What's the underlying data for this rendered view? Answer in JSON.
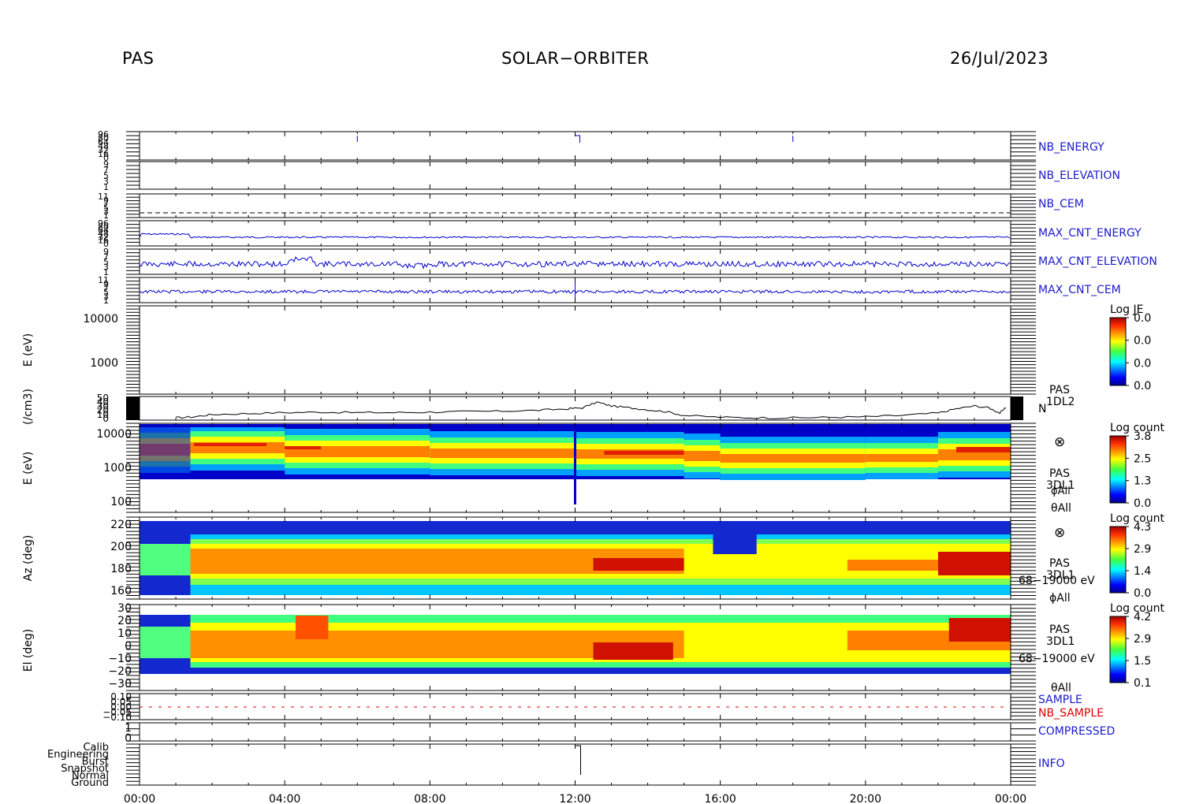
{
  "header": {
    "instrument": "PAS",
    "mission": "SOLAR−ORBITER",
    "date": "26/Jul/2023"
  },
  "colors": {
    "blue_label": "#1a1acc",
    "trace_blue": "#0000cc",
    "red_label": "#dd0000"
  },
  "chart_data": {
    "type": "heatmap",
    "x_ticks": [
      "00:00",
      "04:00",
      "08:00",
      "12:00",
      "16:00",
      "20:00",
      "00:00"
    ],
    "x_hours": [
      0,
      4,
      8,
      12,
      16,
      20,
      24
    ],
    "x_range": [
      0,
      24
    ],
    "hk_panels": [
      {
        "label": "NB_ENERGY",
        "yticks": [
          "96",
          "80",
          "64",
          "48",
          "32",
          "16",
          "0"
        ]
      },
      {
        "label": "NB_ELEVATION",
        "yticks": [
          "9",
          "7",
          "5",
          "3",
          "1"
        ]
      },
      {
        "label": "NB_CEM",
        "yticks": [
          "11",
          "9",
          "7",
          "5",
          "3",
          "1"
        ]
      },
      {
        "label": "MAX_CNT_ENERGY",
        "yticks": [
          "96",
          "80",
          "64",
          "48",
          "32",
          "16",
          "0"
        ]
      },
      {
        "label": "MAX_CNT_ELEVATION",
        "yticks": [
          "9",
          "7",
          "5",
          "3",
          "1"
        ]
      },
      {
        "label": "MAX_CNT_CEM",
        "yticks": [
          "11",
          "9",
          "7",
          "5",
          "3",
          "1"
        ]
      }
    ],
    "empty_spectrogram": {
      "ylabel": "E (eV)",
      "yticks": [
        "10000",
        "1000"
      ],
      "colorbar_title": "Log JE",
      "colorbar_ticks": [
        "0.0",
        "0.0",
        "0.0",
        "0.0"
      ]
    },
    "density": {
      "ylabel": "(/cm3)",
      "yticks": [
        "50",
        "40",
        "30",
        "20",
        "10",
        "0"
      ],
      "right_label_1": "PAS",
      "right_label_2": "1DL2",
      "right_label_3": "N",
      "ylim": [
        0,
        50
      ],
      "series": [
        {
          "x": [
            1.0,
            1.5,
            2.0,
            3.0,
            4.0,
            5.0,
            6.0,
            7.0,
            8.0,
            9.0,
            10.0,
            11.0,
            11.8,
            12.2,
            12.6,
            13.0,
            13.5,
            14.0,
            14.5,
            15.0,
            16.0,
            17.0,
            18.0,
            19.0,
            20.0,
            21.0,
            22.0,
            22.5,
            23.0,
            23.4,
            23.7,
            23.9
          ],
          "y": [
            5,
            7,
            12,
            14,
            16,
            17,
            16,
            16,
            17,
            18,
            19,
            21,
            24,
            26,
            38,
            30,
            26,
            22,
            18,
            10,
            6,
            5,
            5,
            6,
            7,
            10,
            15,
            24,
            30,
            26,
            15,
            28
          ]
        }
      ]
    },
    "energy_spectrogram": {
      "ylabel": "E (eV)",
      "yticks": [
        "10000",
        "1000",
        "100"
      ],
      "labels": [
        "PAS",
        "3DL1",
        "ϕAll",
        "θAll"
      ],
      "colorbar_title": "Log count",
      "colorbar_ticks": [
        "3.8",
        "2.5",
        "1.3",
        "0.0"
      ]
    },
    "azimuth_spectrogram": {
      "ylabel": "Az (deg)",
      "yticks": [
        "220",
        "200",
        "180",
        "160"
      ],
      "labels": [
        "PAS",
        "3DL1",
        "68−19000 eV",
        "ϕAll"
      ],
      "colorbar_title": "Log count",
      "colorbar_ticks": [
        "4.3",
        "2.9",
        "1.4",
        "0.0"
      ]
    },
    "elevation_spectrogram": {
      "ylabel": "El (deg)",
      "yticks": [
        "30",
        "20",
        "10",
        "0",
        "−10",
        "−20",
        "−30"
      ],
      "labels": [
        "PAS",
        "3DL1",
        "68−19000 eV",
        "θAll"
      ],
      "colorbar_title": "Log count",
      "colorbar_ticks": [
        "4.2",
        "2.9",
        "1.5",
        "0.1"
      ]
    },
    "sample_panel": {
      "yticks": [
        "0.10",
        "0.05",
        "0.00",
        "−0.05",
        "−0.10"
      ],
      "label_1": "SAMPLE",
      "label_2": "NB_SAMPLE"
    },
    "compressed_panel": {
      "yticks": [
        "1",
        "0"
      ],
      "label": "COMPRESSED"
    },
    "info_panel": {
      "yticks": [
        "Calib",
        "Engineering",
        "Burst",
        "Snapshot",
        "Normal",
        "Ground"
      ],
      "label": "INFO"
    }
  }
}
